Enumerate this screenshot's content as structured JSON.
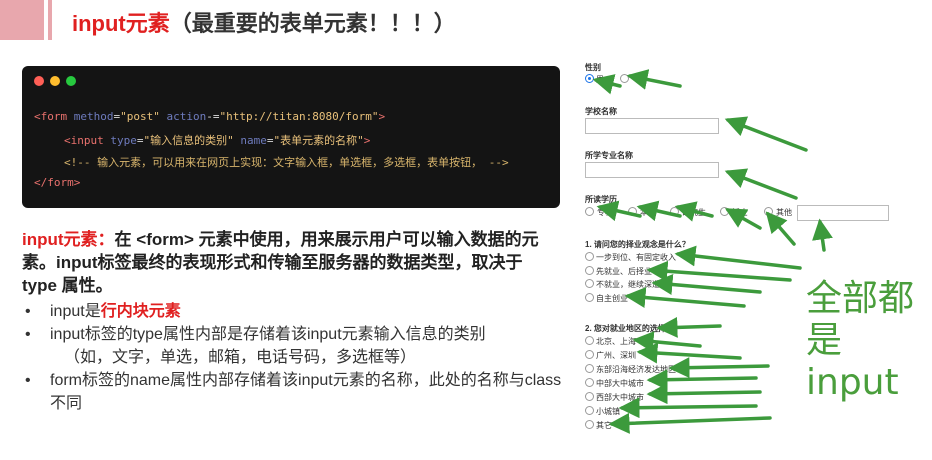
{
  "slide": {
    "title_prefix": "input元素",
    "title_suffix": "（最重要的表单元素！！！）"
  },
  "code": {
    "window_dots": [
      "#ff5f56",
      "#ffbd2e",
      "#27c93f"
    ],
    "line1": {
      "open": "<form",
      "a1": "method",
      "v1": "\"post\"",
      "a2": "action",
      "eq2": "-=",
      "v2": "\"http://titan:8080/form\"",
      "close": ">"
    },
    "line2": {
      "open": "<input",
      "a1": "type",
      "v1": "\"输入信息的类别\"",
      "a2": "name",
      "v2": "\"表单元素的名称\"",
      "close": ">"
    },
    "line3": "<!-- 输入元素，可以用来在网页上实现：文字输入框，单选框，多选框，表单按钮， -->",
    "line4": "</form>"
  },
  "description": {
    "term": "input元素：",
    "text": "在 <form> 元素中使用，用来展示用户可以输入数据的元素。input标签最终的表现形式和传输至服务器的数据类型，取决于 type 属性。"
  },
  "bullets": [
    {
      "prefix": "input是",
      "highlight": "行内块元素"
    },
    {
      "text": "input标签的type属性内部是存储着该input元素输入信息的类别",
      "sub": "（如，文字，单选，邮箱，电话号码，多选框等）"
    },
    {
      "text": "form标签的name属性内部存储着该input元素的名称，此处的名称与class不同"
    }
  ],
  "form_screenshot": {
    "gender_label": "性别",
    "gender_options": [
      "男",
      ""
    ],
    "school_label": "学校名称",
    "major_label": "所学专业名称",
    "degree_label": "所读学历",
    "degree_options": [
      "专科",
      "本科",
      "研究生",
      "博士",
      "其他"
    ],
    "q1": "1. 请问您的择业观念是什么？",
    "q1_options": [
      "一步到位、有固定收入",
      "先就业、后择业",
      "不就业，继续深造",
      "自主创业"
    ],
    "q2": "2. 您对就业地区的选择是：",
    "q2_options": [
      "北京、上海",
      "广州、深圳",
      "东部沿海经济发达地区",
      "中部大中城市",
      "西部大中城市",
      "小城镇",
      "其它"
    ]
  },
  "annotation": {
    "line1": "全部都",
    "line2": "是input",
    "color": "#4a9e3c"
  },
  "colors": {
    "accent": "#e8a7ad",
    "highlight": "#e02020",
    "code_bg": "#141414"
  }
}
